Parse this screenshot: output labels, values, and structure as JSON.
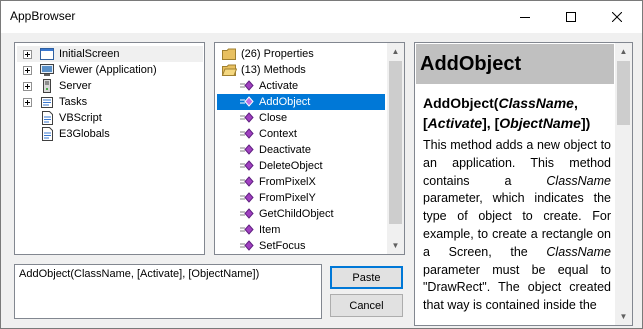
{
  "window": {
    "title": "AppBrowser"
  },
  "tree": {
    "items": [
      {
        "label": "InitialScreen",
        "icon": "window-icon",
        "expandable": true
      },
      {
        "label": "Viewer (Application)",
        "icon": "viewer-icon",
        "expandable": true
      },
      {
        "label": "Server",
        "icon": "server-icon",
        "expandable": true
      },
      {
        "label": "Tasks",
        "icon": "tasks-icon",
        "expandable": true
      },
      {
        "label": "VBScript",
        "icon": "script-icon",
        "expandable": false
      },
      {
        "label": "E3Globals",
        "icon": "globals-icon",
        "expandable": false
      }
    ]
  },
  "members": {
    "folders": [
      {
        "label": "(26) Properties",
        "icon": "folder-icon"
      },
      {
        "label": "(13) Methods",
        "icon": "folder-open-icon"
      }
    ],
    "methods": [
      {
        "label": "Activate"
      },
      {
        "label": "AddObject",
        "selected": true
      },
      {
        "label": "Close"
      },
      {
        "label": "Context"
      },
      {
        "label": "Deactivate"
      },
      {
        "label": "DeleteObject"
      },
      {
        "label": "FromPixelX"
      },
      {
        "label": "FromPixelY"
      },
      {
        "label": "GetChildObject"
      },
      {
        "label": "Item"
      },
      {
        "label": "SetFocus"
      }
    ]
  },
  "help": {
    "header": "AddObject",
    "signature": {
      "name": "AddObject(",
      "p1": "ClassName",
      "sep1": ", [",
      "p2": "Activate",
      "sep2": "], [",
      "p3": "ObjectName",
      "end": "])"
    },
    "body": {
      "t1": "This method adds a new object to an application. This method contains a ",
      "i1": "ClassName",
      "t2": " parameter, which indicates the type of object to create. For example, to create a rectangle on a Screen, the ",
      "i2": "ClassName",
      "t3": " parameter must be equal to \"DrawRect\". The object created that way is contained inside the"
    }
  },
  "syntax": {
    "value": "AddObject(ClassName, [Activate], [ObjectName])"
  },
  "buttons": {
    "paste": "Paste",
    "cancel": "Cancel"
  },
  "colors": {
    "selection": "#0078d7",
    "method_icon": "#a040c0",
    "folder": "#e8c060"
  }
}
